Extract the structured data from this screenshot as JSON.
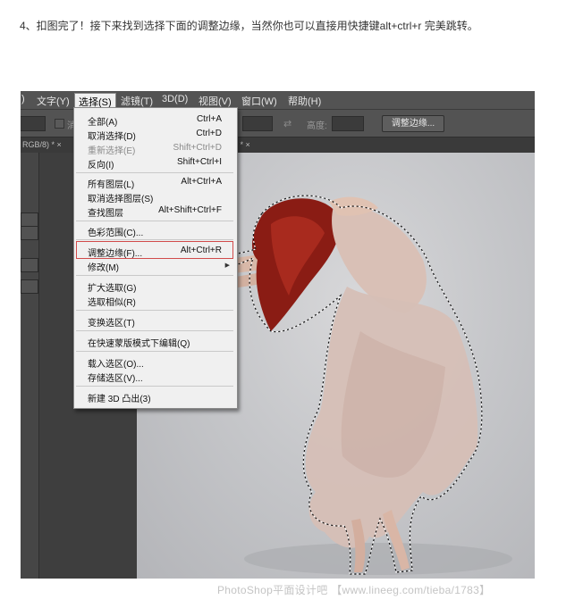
{
  "caption": "4、扣图完了！接下来找到选择下面的调整边缘，当然你也可以直接用快捷键alt+ctrl+r 完美跳转。",
  "menubar": {
    "items": [
      ")",
      "文字(Y)",
      "选择(S)",
      "滤镜(T)",
      "3D(D)",
      "视图(V)",
      "窗口(W)",
      "帮助(H)"
    ]
  },
  "options_bar": {
    "left_partial": "表",
    "check_partial": "消",
    "height_label": "高度:",
    "refine_edge_button": "调整边缘..."
  },
  "doc_tabs": {
    "tab1": "RGB/8) * ×",
    "tab2": "8) * ×"
  },
  "select_menu": {
    "items": [
      {
        "label": "全部(A)",
        "shortcut": "Ctrl+A"
      },
      {
        "label": "取消选择(D)",
        "shortcut": "Ctrl+D"
      },
      {
        "label": "重新选择(E)",
        "shortcut": "Shift+Ctrl+D",
        "disabled": true
      },
      {
        "label": "反向(I)",
        "shortcut": "Shift+Ctrl+I"
      },
      {
        "label": "所有图层(L)",
        "shortcut": "Alt+Ctrl+A"
      },
      {
        "label": "取消选择图层(S)",
        "shortcut": ""
      },
      {
        "label": "查找图层",
        "shortcut": "Alt+Shift+Ctrl+F"
      },
      {
        "label": "色彩范围(C)...",
        "shortcut": ""
      },
      {
        "label": "调整边缘(F)...",
        "shortcut": "Alt+Ctrl+R",
        "highlighted": true
      },
      {
        "label": "修改(M)",
        "shortcut": "",
        "submenu": true
      },
      {
        "label": "扩大选取(G)",
        "shortcut": ""
      },
      {
        "label": "选取相似(R)",
        "shortcut": ""
      },
      {
        "label": "变换选区(T)",
        "shortcut": ""
      },
      {
        "label": "在快速蒙版模式下编辑(Q)",
        "shortcut": ""
      },
      {
        "label": "载入选区(O)...",
        "shortcut": ""
      },
      {
        "label": "存储选区(V)...",
        "shortcut": ""
      },
      {
        "label": "新建 3D 凸出(3)",
        "shortcut": ""
      }
    ]
  },
  "watermark": "PhotoShop平面设计吧 【www.lineeg.com/tieba/1783】",
  "colors": {
    "menu_bg": "#f0f0f0",
    "app_bg": "#535353",
    "highlight_border": "#d14b4b",
    "canvas_bg": "#c6c7ca"
  }
}
